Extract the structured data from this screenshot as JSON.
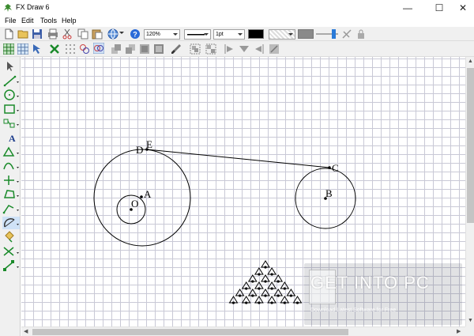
{
  "window": {
    "title": "FX Draw 6",
    "minimize_glyph": "—",
    "maximize_glyph": "☐",
    "close_glyph": "✕"
  },
  "menu": {
    "items": [
      "File",
      "Edit",
      "Tools",
      "Help"
    ]
  },
  "toolbar": {
    "zoom": "120%",
    "line_weight": "1pt",
    "line_color": "#000000",
    "icons": [
      "new-file-icon",
      "open-folder-icon",
      "save-icon",
      "print-icon",
      "cut-icon",
      "copy-icon",
      "paste-icon",
      "globe-icon",
      "help-icon",
      "line-style-icon",
      "fill-color-icon",
      "fill-pattern-icon",
      "opacity-slider",
      "link-off-icon",
      "lock-icon"
    ]
  },
  "toolbar2": {
    "icons": [
      "grid-icon",
      "snap-grid-icon",
      "select-arrow-icon",
      "delete-x-icon",
      "dot-grid-icon",
      "circles-icon",
      "link-circles-icon",
      "bring-forward-icon",
      "send-backward-icon",
      "bring-front-icon",
      "send-back-icon",
      "brush-icon",
      "group-icon",
      "ungroup-icon",
      "align-left-icon",
      "align-center-icon",
      "align-right-icon",
      "align-top-icon"
    ]
  },
  "tools": [
    "pointer-tool",
    "line-tool",
    "circle-tool",
    "rectangle-tool",
    "transform-tool",
    "text-tool",
    "shape-tool",
    "curve-tool",
    "axis-tool",
    "polygon-tool",
    "function-tool",
    "arc-tool",
    "fill-tool",
    "snap-tool",
    "edit-points-tool"
  ],
  "drawing": {
    "points": [
      "O",
      "A",
      "B",
      "C",
      "D",
      "E"
    ]
  },
  "watermark": {
    "text": "GET INTO PC",
    "subtext": "Download Latest Software for Free"
  },
  "colors": {
    "line": "#000000",
    "grid": "#c9c9d6",
    "toolbar_bg": "#f0f0f0"
  }
}
